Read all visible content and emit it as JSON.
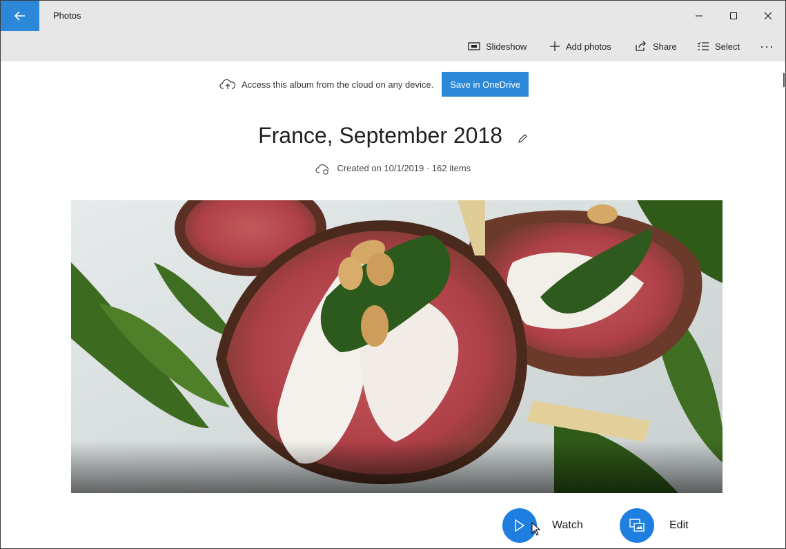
{
  "app": {
    "title": "Photos"
  },
  "titlebar": {
    "back_icon": "back-arrow-icon",
    "minimize_glyph": "–",
    "maximize_glyph": "☐",
    "close_glyph": "✕"
  },
  "toolbar": {
    "slideshow": "Slideshow",
    "add_photos": "Add photos",
    "share": "Share",
    "select": "Select",
    "more": "···"
  },
  "banner": {
    "text": "Access this album from the cloud on any device.",
    "button": "Save in OneDrive"
  },
  "album": {
    "title": "France, September 2018",
    "meta": "Created on 10/1/2019 · 162 items"
  },
  "actions": {
    "watch": "Watch",
    "edit": "Edit"
  },
  "colors": {
    "accent": "#2b88d8",
    "action_blue": "#1f7fe0",
    "titlebar_bg": "#e7e7e7"
  }
}
